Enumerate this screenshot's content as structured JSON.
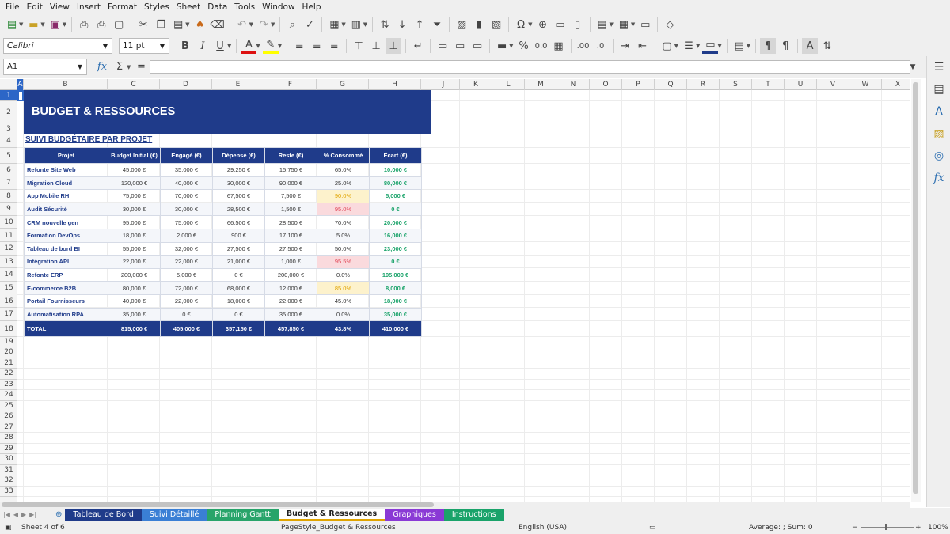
{
  "menu": [
    "File",
    "Edit",
    "View",
    "Insert",
    "Format",
    "Styles",
    "Sheet",
    "Data",
    "Tools",
    "Window",
    "Help"
  ],
  "font": {
    "name": "Calibri",
    "size": "11 pt"
  },
  "namebox": "A1",
  "formula_icons": {
    "fx": "fx",
    "sum": "Σ",
    "eq": "="
  },
  "columns": [
    "A",
    "B",
    "C",
    "D",
    "E",
    "F",
    "G",
    "H",
    "I",
    "J",
    "K",
    "L",
    "M",
    "N",
    "O",
    "P",
    "Q",
    "R",
    "S",
    "T",
    "U",
    "V",
    "W",
    "X"
  ],
  "rows": [
    "1",
    "2",
    "3",
    "4",
    "5",
    "6",
    "7",
    "8",
    "9",
    "10",
    "11",
    "12",
    "13",
    "14",
    "15",
    "16",
    "17",
    "18",
    "19",
    "20",
    "21",
    "22",
    "23",
    "24",
    "25",
    "26",
    "27",
    "28",
    "29",
    "30",
    "31",
    "32",
    "33"
  ],
  "sheet": {
    "title": "BUDGET & RESSOURCES",
    "subtitle": "SUIVI BUDGÉTAIRE PAR PROJET",
    "headers": [
      "Projet",
      "Budget Initial (€)",
      "Engagé (€)",
      "Dépensé (€)",
      "Reste (€)",
      "% Consommé",
      "Écart (€)"
    ],
    "rows": [
      {
        "projet": "Refonte Site Web",
        "budget": "45,000 €",
        "engage": "35,000 €",
        "depense": "29,250 €",
        "reste": "15,750 €",
        "pct": "65.0%",
        "ecart": "10,000 €",
        "pct_status": "normal"
      },
      {
        "projet": "Migration Cloud",
        "budget": "120,000 €",
        "engage": "40,000 €",
        "depense": "30,000 €",
        "reste": "90,000 €",
        "pct": "25.0%",
        "ecart": "80,000 €",
        "pct_status": "normal"
      },
      {
        "projet": "App Mobile RH",
        "budget": "75,000 €",
        "engage": "70,000 €",
        "depense": "67,500 €",
        "reste": "7,500 €",
        "pct": "90.0%",
        "ecart": "5,000 €",
        "pct_status": "warn"
      },
      {
        "projet": "Audit Sécurité",
        "budget": "30,000 €",
        "engage": "30,000 €",
        "depense": "28,500 €",
        "reste": "1,500 €",
        "pct": "95.0%",
        "ecart": "0 €",
        "pct_status": "danger"
      },
      {
        "projet": "CRM nouvelle gen",
        "budget": "95,000 €",
        "engage": "75,000 €",
        "depense": "66,500 €",
        "reste": "28,500 €",
        "pct": "70.0%",
        "ecart": "20,000 €",
        "pct_status": "normal"
      },
      {
        "projet": "Formation DevOps",
        "budget": "18,000 €",
        "engage": "2,000 €",
        "depense": "900 €",
        "reste": "17,100 €",
        "pct": "5.0%",
        "ecart": "16,000 €",
        "pct_status": "normal"
      },
      {
        "projet": "Tableau de bord BI",
        "budget": "55,000 €",
        "engage": "32,000 €",
        "depense": "27,500 €",
        "reste": "27,500 €",
        "pct": "50.0%",
        "ecart": "23,000 €",
        "pct_status": "normal"
      },
      {
        "projet": "Intégration API",
        "budget": "22,000 €",
        "engage": "22,000 €",
        "depense": "21,000 €",
        "reste": "1,000 €",
        "pct": "95.5%",
        "ecart": "0 €",
        "pct_status": "danger"
      },
      {
        "projet": "Refonte ERP",
        "budget": "200,000 €",
        "engage": "5,000 €",
        "depense": "0 €",
        "reste": "200,000 €",
        "pct": "0.0%",
        "ecart": "195,000 €",
        "pct_status": "normal"
      },
      {
        "projet": "E-commerce B2B",
        "budget": "80,000 €",
        "engage": "72,000 €",
        "depense": "68,000 €",
        "reste": "12,000 €",
        "pct": "85.0%",
        "ecart": "8,000 €",
        "pct_status": "warn"
      },
      {
        "projet": "Portail Fournisseurs",
        "budget": "40,000 €",
        "engage": "22,000 €",
        "depense": "18,000 €",
        "reste": "22,000 €",
        "pct": "45.0%",
        "ecart": "18,000 €",
        "pct_status": "normal"
      },
      {
        "projet": "Automatisation RPA",
        "budget": "35,000 €",
        "engage": "0 €",
        "depense": "0 €",
        "reste": "35,000 €",
        "pct": "0.0%",
        "ecart": "35,000 €",
        "pct_status": "normal"
      }
    ],
    "total": {
      "projet": "TOTAL",
      "budget": "815,000 €",
      "engage": "405,000 €",
      "depense": "357,150 €",
      "reste": "457,850 €",
      "pct": "43.8%",
      "ecart": "410,000 €"
    }
  },
  "tabs": [
    {
      "label": "Tableau de Bord",
      "color": "#1f3b8a",
      "active": false
    },
    {
      "label": "Suivi Détaillé",
      "color": "#3a7fd5",
      "active": false
    },
    {
      "label": "Planning Gantt",
      "color": "#28a46a",
      "active": false
    },
    {
      "label": "Budget & Ressources",
      "color": "#ffffff",
      "active": true
    },
    {
      "label": "Graphiques",
      "color": "#8a3ad5",
      "active": false
    },
    {
      "label": "Instructions",
      "color": "#1aa36a",
      "active": false
    }
  ],
  "status": {
    "sheet": "Sheet 4 of 6",
    "pagestyle": "PageStyle_Budget & Ressources",
    "lang": "English (USA)",
    "sum": "Average: ; Sum: 0",
    "zoom": "100%"
  },
  "colors": {
    "accent": "#1f3b8a",
    "green": "#1aa36a",
    "warn": "#e0a400",
    "danger": "#e24a5a"
  }
}
